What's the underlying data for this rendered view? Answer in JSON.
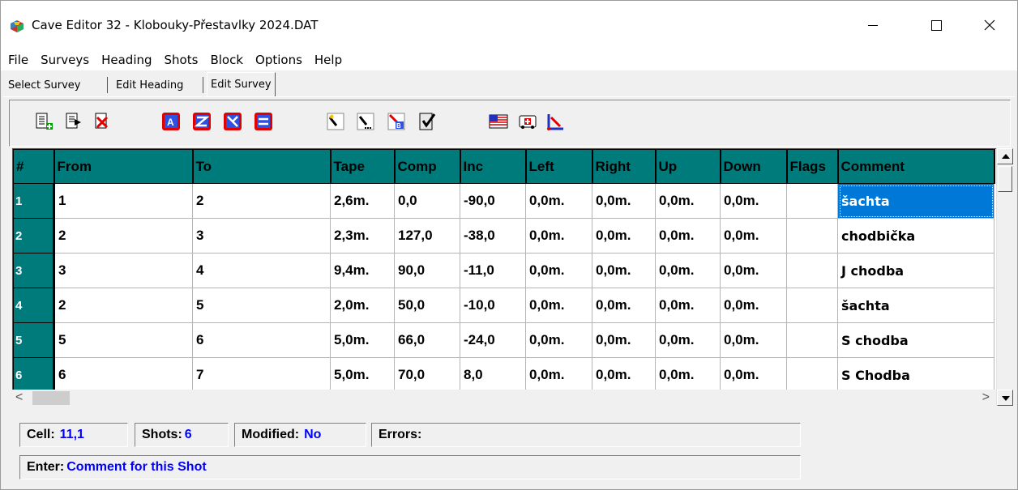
{
  "window": {
    "title": "Cave Editor 32 - Klobouky-Přestavlky 2024.DAT"
  },
  "menu": [
    "File",
    "Surveys",
    "Heading",
    "Shots",
    "Block",
    "Options",
    "Help"
  ],
  "tabs": {
    "select_survey": "Select Survey",
    "edit_heading": "Edit Heading",
    "edit_survey": "Edit Survey",
    "active": "Edit Survey"
  },
  "toolbar": {
    "buttons": [
      "insert-shot-icon",
      "append-shot-icon",
      "delete-shot-icon",
      "reverse-shots-icon",
      "compass-reverse-icon",
      "inclination-reverse-icon",
      "swap-tape-icon",
      "highlight-icon",
      "fill-down-icon",
      "text-replace-icon",
      "check-icon",
      "flag-icon",
      "calculator-icon",
      "axes-icon"
    ]
  },
  "grid": {
    "headers": [
      "#",
      "From",
      "To",
      "Tape",
      "Comp",
      "Inc",
      "Left",
      "Right",
      "Up",
      "Down",
      "Flags",
      "Comment"
    ],
    "rows": [
      {
        "n": "1",
        "from": "1",
        "to": "2",
        "tape": "2,6m.",
        "comp": "0,0",
        "inc": "-90,0",
        "left": "0,0m.",
        "right": "0,0m.",
        "up": "0,0m.",
        "down": "0,0m.",
        "flags": "",
        "comment": "šachta"
      },
      {
        "n": "2",
        "from": "2",
        "to": "3",
        "tape": "2,3m.",
        "comp": "127,0",
        "inc": "-38,0",
        "left": "0,0m.",
        "right": "0,0m.",
        "up": "0,0m.",
        "down": "0,0m.",
        "flags": "",
        "comment": "chodbička"
      },
      {
        "n": "3",
        "from": "3",
        "to": "4",
        "tape": "9,4m.",
        "comp": "90,0",
        "inc": "-11,0",
        "left": "0,0m.",
        "right": "0,0m.",
        "up": "0,0m.",
        "down": "0,0m.",
        "flags": "",
        "comment": "J chodba"
      },
      {
        "n": "4",
        "from": "2",
        "to": "5",
        "tape": "2,0m.",
        "comp": "50,0",
        "inc": "-10,0",
        "left": "0,0m.",
        "right": "0,0m.",
        "up": "0,0m.",
        "down": "0,0m.",
        "flags": "",
        "comment": "šachta"
      },
      {
        "n": "5",
        "from": "5",
        "to": "6",
        "tape": "5,0m.",
        "comp": "66,0",
        "inc": "-24,0",
        "left": "0,0m.",
        "right": "0,0m.",
        "up": "0,0m.",
        "down": "0,0m.",
        "flags": "",
        "comment": "S chodba"
      },
      {
        "n": "6",
        "from": "6",
        "to": "7",
        "tape": "5,0m.",
        "comp": "70,0",
        "inc": "8,0",
        "left": "0,0m.",
        "right": "0,0m.",
        "up": "0,0m.",
        "down": "0,0m.",
        "flags": "",
        "comment": "S Chodba"
      }
    ],
    "selected_cell": {
      "row": 1,
      "column": "Comment"
    }
  },
  "status": {
    "cell_label": "Cell:",
    "cell_value": "11,1",
    "shots_label": "Shots:",
    "shots_value": "6",
    "modified_label": "Modified:",
    "modified_value": "No",
    "errors_label": "Errors:",
    "enter_label": "Enter:",
    "enter_value": "Comment for this Shot"
  },
  "colors": {
    "grid_header": "#007b7b",
    "selection": "#0078d7",
    "status_value": "#0000ff"
  }
}
